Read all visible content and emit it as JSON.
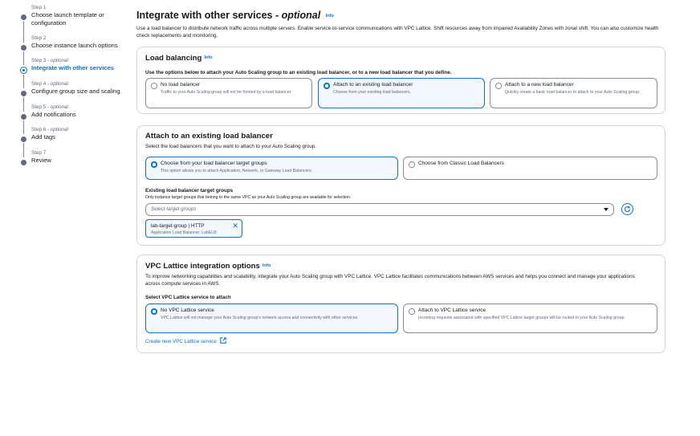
{
  "steps": [
    {
      "num": "Step 1",
      "title": "Choose launch template or configuration"
    },
    {
      "num": "Step 2",
      "title": "Choose instance launch options"
    },
    {
      "num": "Step 3",
      "optional": "optional",
      "title": "Integrate with other services"
    },
    {
      "num": "Step 4",
      "optional": "optional",
      "title": "Configure group size and scaling"
    },
    {
      "num": "Step 5",
      "optional": "optional",
      "title": "Add notifications"
    },
    {
      "num": "Step 6",
      "optional": "optional",
      "title": "Add tags"
    },
    {
      "num": "Step 7",
      "title": "Review"
    }
  ],
  "page": {
    "title": "Integrate with other services - ",
    "title_optional": "optional",
    "info": "Info",
    "description": "Use a load balancer to distribute network traffic across multiple servers. Enable service-to-service communications with VPC Lattice. Shift resources away from impaired Availability Zones with zonal shift. You can also customize health check replacements and monitoring."
  },
  "load_balancing": {
    "title": "Load balancing",
    "info": "Info",
    "instruction": "Use the options below to attach your Auto Scaling group to an existing load balancer, or to a new load balancer that you define.",
    "options": [
      {
        "label": "No load balancer",
        "desc": "Traffic to your Auto Scaling group will not be fronted by a load balancer.",
        "selected": false
      },
      {
        "label": "Attach to an existing load balancer",
        "desc": "Choose from your existing load balancers.",
        "selected": true
      },
      {
        "label": "Attach to a new load balancer",
        "desc": "Quickly create a basic load balancer to attach to your Auto Scaling group.",
        "selected": false
      }
    ]
  },
  "attach_existing": {
    "title": "Attach to an existing load balancer",
    "subtitle": "Select the load balancers that you want to attach to your Auto Scaling group.",
    "options": [
      {
        "label": "Choose from your load balancer target groups",
        "desc": "This option allows you to attach Application, Network, or Gateway Load Balancers.",
        "selected": true
      },
      {
        "label": "Choose from Classic Load Balancers",
        "desc": "",
        "selected": false
      }
    ],
    "target_groups_label": "Existing load balancer target groups",
    "target_groups_hint": "Only instance target groups that belong to the same VPC as your Auto Scaling group are available for selection.",
    "select_placeholder": "Select target groups",
    "token_name": "lab-target-group | HTTP",
    "token_desc": "Application Load Balancer: LabELB",
    "token_remove": "✕"
  },
  "vpc_lattice": {
    "title": "VPC Lattice integration options",
    "info": "Info",
    "description": "To improve networking capabilities and scalability, integrate your Auto Scaling group with VPC Lattice. VPC Lattice facilitates communications between AWS services and helps you connect and manage your applications across compute services in AWS.",
    "select_label": "Select VPC Lattice service to attach",
    "options": [
      {
        "label": "No VPC Lattice service",
        "desc": "VPC Lattice will not manage your Auto Scaling group's network access and connectivity with other services.",
        "selected": true
      },
      {
        "label": "Attach to VPC Lattice service",
        "desc": "Incoming requests associated with specified VPC Lattice target groups will be routed to your Auto Scaling group.",
        "selected": false
      }
    ],
    "create_link": "Create new VPC Lattice service"
  },
  "colors": {
    "accent": "#0972d3",
    "selected_bg": "#f2f8fd",
    "border": "#8c8c94"
  },
  "icons": [
    "step-dot-icon",
    "radio-icon",
    "caret-down-icon",
    "refresh-icon",
    "close-icon",
    "external-link-icon"
  ]
}
